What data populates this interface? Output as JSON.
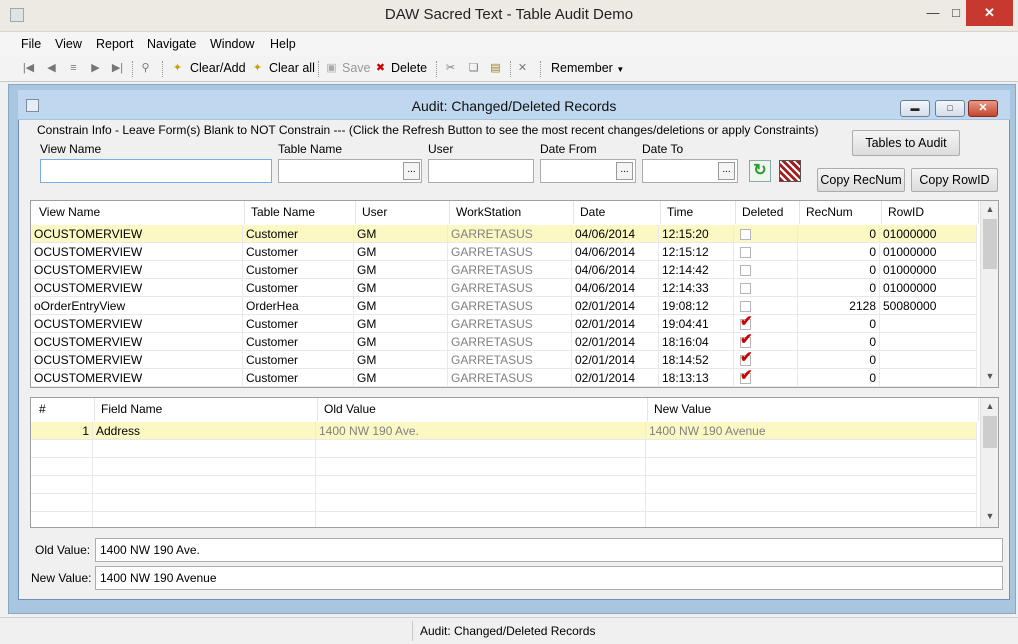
{
  "app": {
    "title": "DAW Sacred Text - Table Audit Demo"
  },
  "menu": [
    "File",
    "View",
    "Report",
    "Navigate",
    "Window",
    "Help"
  ],
  "toolbar": {
    "clear_add": "Clear/Add",
    "clear_all": "Clear all",
    "save": "Save",
    "delete": "Delete",
    "remember": "Remember"
  },
  "audit_window": {
    "title": "Audit: Changed/Deleted Records",
    "constrain_info": "Constrain Info - Leave Form(s) Blank to NOT Constrain --- (Click the Refresh Button to see the most recent changes/deletions or apply Constraints)",
    "fields": {
      "view_name": {
        "label": "View Name",
        "value": ""
      },
      "table_name": {
        "label": "Table Name",
        "value": ""
      },
      "user": {
        "label": "User",
        "value": ""
      },
      "date_from": {
        "label": "Date From",
        "value": ""
      },
      "date_to": {
        "label": "Date To",
        "value": ""
      }
    },
    "buttons": {
      "tables_to_audit": "Tables to Audit",
      "copy_recnum": "Copy RecNum",
      "copy_rowid": "Copy RowID"
    },
    "records_grid": {
      "columns": [
        "View Name",
        "Table Name",
        "User",
        "WorkStation",
        "Date",
        "Time",
        "Deleted",
        "RecNum",
        "RowID"
      ],
      "rows": [
        {
          "view": "OCUSTOMERVIEW",
          "table": "Customer",
          "user": "GM",
          "ws": "GARRETASUS",
          "date": "04/06/2014",
          "time": "12:15:20",
          "deleted": false,
          "recnum": "0",
          "rowid": "01000000"
        },
        {
          "view": "OCUSTOMERVIEW",
          "table": "Customer",
          "user": "GM",
          "ws": "GARRETASUS",
          "date": "04/06/2014",
          "time": "12:15:12",
          "deleted": false,
          "recnum": "0",
          "rowid": "01000000"
        },
        {
          "view": "OCUSTOMERVIEW",
          "table": "Customer",
          "user": "GM",
          "ws": "GARRETASUS",
          "date": "04/06/2014",
          "time": "12:14:42",
          "deleted": false,
          "recnum": "0",
          "rowid": "01000000"
        },
        {
          "view": "OCUSTOMERVIEW",
          "table": "Customer",
          "user": "GM",
          "ws": "GARRETASUS",
          "date": "04/06/2014",
          "time": "12:14:33",
          "deleted": false,
          "recnum": "0",
          "rowid": "01000000"
        },
        {
          "view": "oOrderEntryView",
          "table": "OrderHea",
          "user": "GM",
          "ws": "GARRETASUS",
          "date": "02/01/2014",
          "time": "19:08:12",
          "deleted": false,
          "recnum": "2128",
          "rowid": "50080000"
        },
        {
          "view": "OCUSTOMERVIEW",
          "table": "Customer",
          "user": "GM",
          "ws": "GARRETASUS",
          "date": "02/01/2014",
          "time": "19:04:41",
          "deleted": true,
          "recnum": "0",
          "rowid": ""
        },
        {
          "view": "OCUSTOMERVIEW",
          "table": "Customer",
          "user": "GM",
          "ws": "GARRETASUS",
          "date": "02/01/2014",
          "time": "18:16:04",
          "deleted": true,
          "recnum": "0",
          "rowid": ""
        },
        {
          "view": "OCUSTOMERVIEW",
          "table": "Customer",
          "user": "GM",
          "ws": "GARRETASUS",
          "date": "02/01/2014",
          "time": "18:14:52",
          "deleted": true,
          "recnum": "0",
          "rowid": ""
        },
        {
          "view": "OCUSTOMERVIEW",
          "table": "Customer",
          "user": "GM",
          "ws": "GARRETASUS",
          "date": "02/01/2014",
          "time": "18:13:13",
          "deleted": true,
          "recnum": "0",
          "rowid": ""
        }
      ]
    },
    "fields_grid": {
      "columns": [
        "#",
        "Field Name",
        "Old Value",
        "New Value"
      ],
      "rows": [
        {
          "num": "1",
          "field": "Address",
          "old": "1400 NW 190 Ave.",
          "new": "1400 NW 190 Avenue"
        }
      ]
    },
    "old_value": {
      "label": "Old Value:",
      "value": "1400 NW 190 Ave."
    },
    "new_value": {
      "label": "New Value:",
      "value": "1400 NW 190 Avenue"
    }
  },
  "status": {
    "text": "Audit: Changed/Deleted Records"
  },
  "colors": {
    "selected_row": "#fbf8c3",
    "mdi_background": "#a8c6e0",
    "inner_title": "#c0d8ef",
    "check_red": "#cc0000"
  }
}
